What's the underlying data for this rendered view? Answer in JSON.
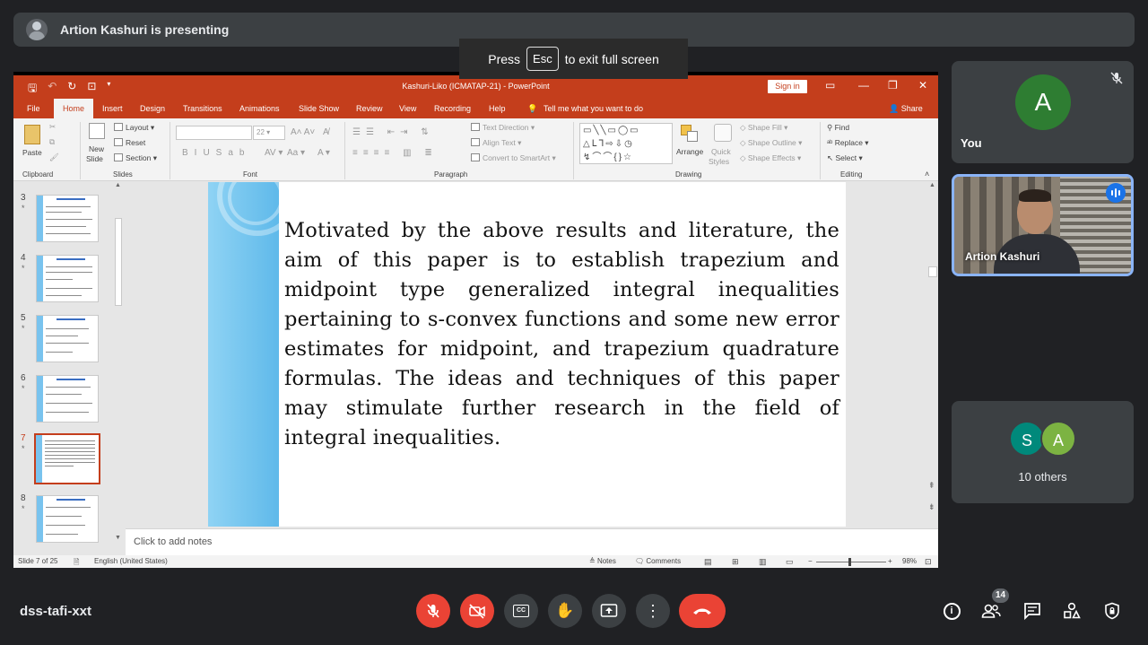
{
  "presenter_bar": {
    "text": "Artion Kashuri is presenting"
  },
  "fullscreen_notice": {
    "press": "Press",
    "key": "Esc",
    "rest": "to exit full screen"
  },
  "powerpoint": {
    "window_title": "Kashuri-Liko (ICMATAP-21) - PowerPoint",
    "sign_in": "Sign in",
    "tabs": [
      "File",
      "Home",
      "Insert",
      "Design",
      "Transitions",
      "Animations",
      "Slide Show",
      "Review",
      "View",
      "Recording",
      "Help"
    ],
    "tell_me": "Tell me what you want to do",
    "share": "Share",
    "ribbon": {
      "paste": "Paste",
      "new_slide_1": "New",
      "new_slide_2": "Slide",
      "layout": "Layout",
      "reset": "Reset",
      "section": "Section",
      "font_size": "22",
      "text_direction": "Text Direction",
      "align_text": "Align Text",
      "convert_smartart": "Convert to SmartArt",
      "arrange": "Arrange",
      "quick_styles_1": "Quick",
      "quick_styles_2": "Styles",
      "shape_fill": "Shape Fill",
      "shape_outline": "Shape Outline",
      "shape_effects": "Shape Effects",
      "find": "Find",
      "replace": "Replace",
      "select": "Select",
      "groups": [
        "Clipboard",
        "Slides",
        "Font",
        "Paragraph",
        "Drawing",
        "Editing"
      ]
    },
    "thumbnails": [
      {
        "num": "3"
      },
      {
        "num": "4"
      },
      {
        "num": "5"
      },
      {
        "num": "6"
      },
      {
        "num": "7",
        "active": true
      },
      {
        "num": "8"
      }
    ],
    "slide_text": "Motivated by the above results and literature, the aim of this paper is to establish trapezium and midpoint type generalized integral inequalities pertaining to s-convex functions and some new error estimates for midpoint, and trapezium quadrature formulas. The ideas and techniques of this paper may stimulate further research in the field of integral inequalities.",
    "notes_placeholder": "Click to add notes",
    "status": {
      "slide_count": "Slide 7 of 25",
      "language": "English (United States)",
      "notes": "Notes",
      "comments": "Comments",
      "zoom": "98%"
    }
  },
  "tiles": {
    "you": {
      "initial": "A",
      "name": "You"
    },
    "artion": {
      "name": "Artion Kashuri"
    },
    "others": {
      "initials": [
        "S",
        "A"
      ],
      "label": "10 others"
    }
  },
  "bottom": {
    "meeting_code": "dss-tafi-xxt",
    "participant_count": "14"
  },
  "colors": {
    "accent_red": "#ea4335",
    "ppt_orange": "#c43e1c",
    "speaker_blue": "#8ab4f8"
  }
}
